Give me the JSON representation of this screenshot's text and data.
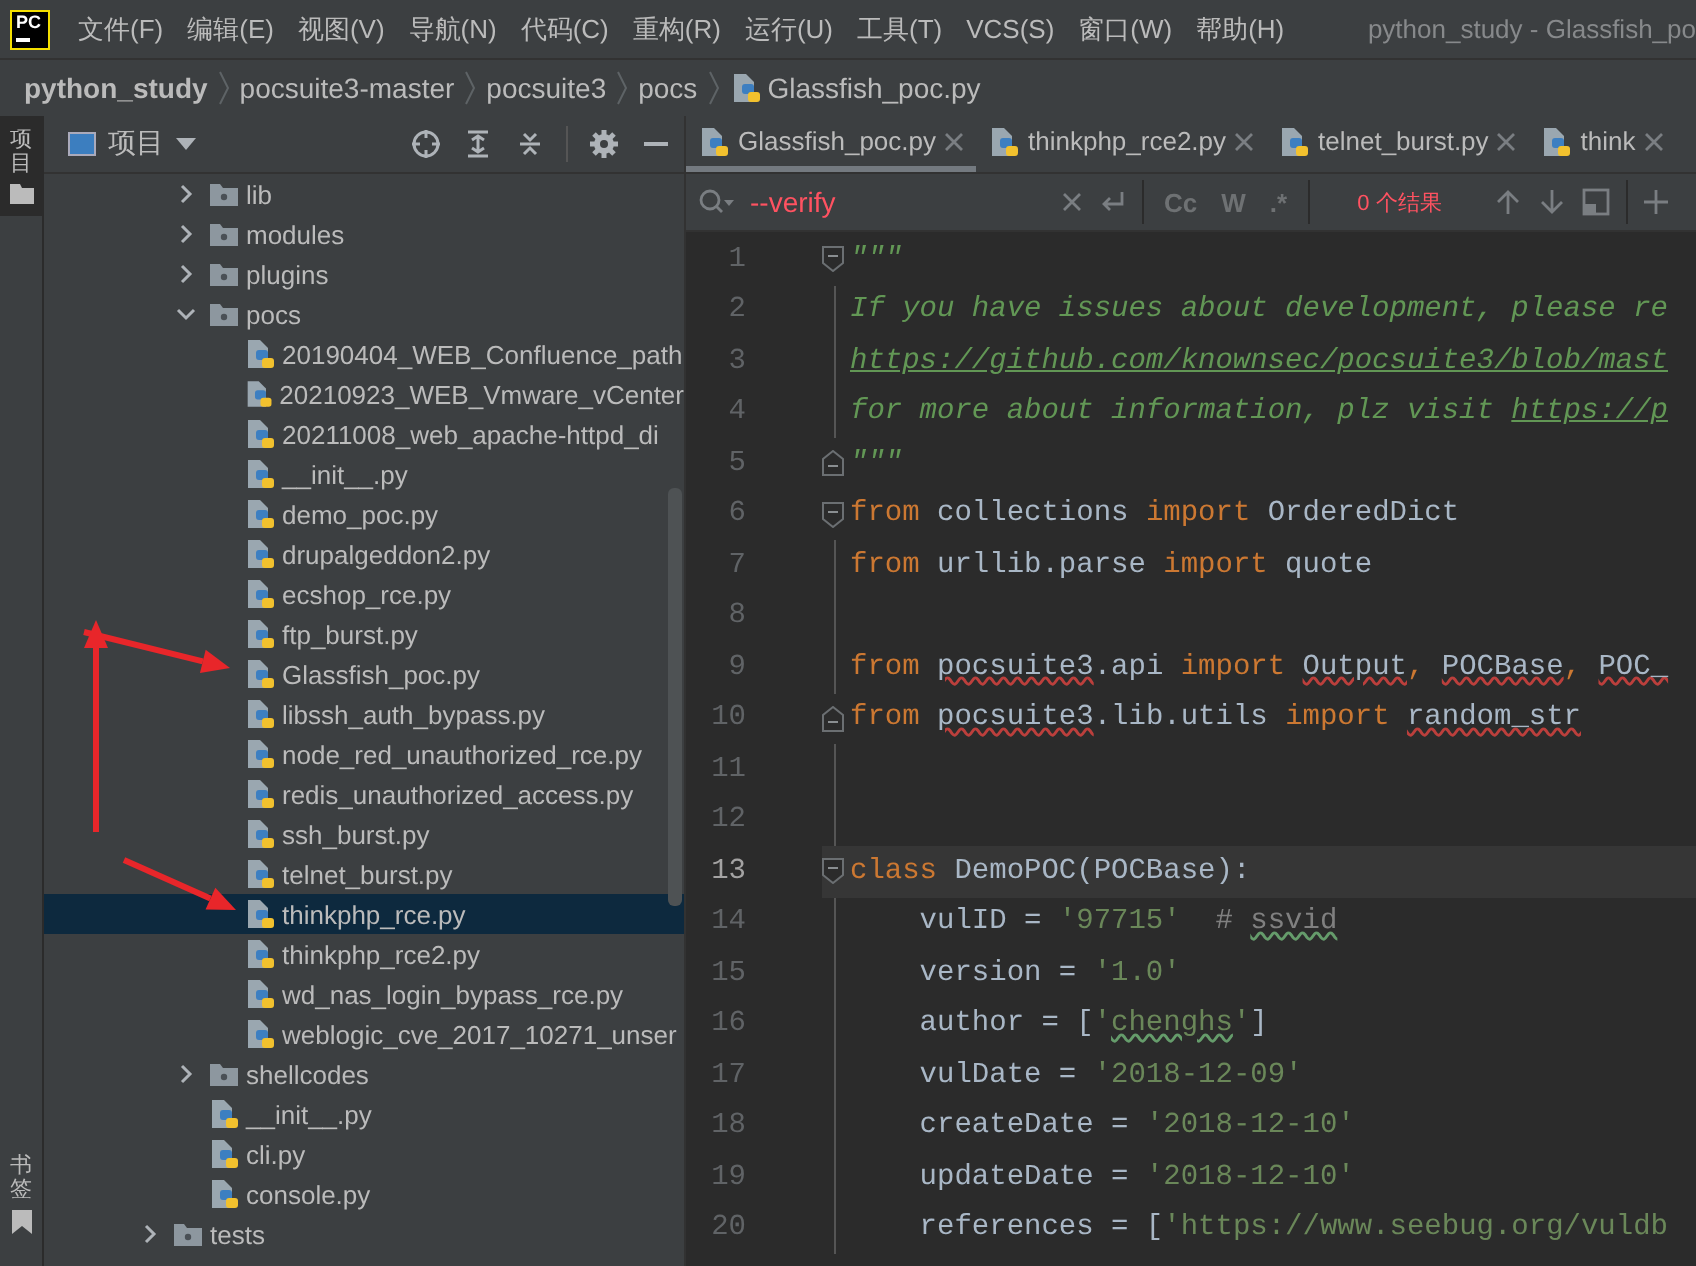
{
  "menu_bar": {
    "logo": "PC",
    "items": [
      "文件(F)",
      "编辑(E)",
      "视图(V)",
      "导航(N)",
      "代码(C)",
      "重构(R)",
      "运行(U)",
      "工具(T)",
      "VCS(S)",
      "窗口(W)",
      "帮助(H)"
    ],
    "title": "python_study - Glassfish_po"
  },
  "breadcrumb": [
    {
      "label": "python_study",
      "kind": "root"
    },
    {
      "label": "pocsuite3-master",
      "kind": "folder"
    },
    {
      "label": "pocsuite3",
      "kind": "folder"
    },
    {
      "label": "pocs",
      "kind": "folder"
    },
    {
      "label": "Glassfish_poc.py",
      "kind": "file"
    }
  ],
  "side_strip": {
    "top": "项目",
    "bottom": "书签"
  },
  "project": {
    "title": "项目",
    "tree": [
      {
        "children": [
          {
            "label": "lib",
            "kind": "folder",
            "expanded": false,
            "selected": false
          },
          {
            "label": "modules",
            "kind": "folder",
            "expanded": false,
            "selected": false
          },
          {
            "label": "plugins",
            "kind": "folder",
            "expanded": false,
            "selected": false
          },
          {
            "label": "pocs",
            "kind": "folder",
            "expanded": true,
            "selected": false,
            "children": [
              {
                "label": "20190404_WEB_Confluence_path",
                "kind": "file",
                "selected": false
              },
              {
                "label": "20210923_WEB_Vmware_vCenter",
                "kind": "file",
                "selected": false
              },
              {
                "label": "20211008_web_apache-httpd_di",
                "kind": "file",
                "selected": false
              },
              {
                "label": "__init__.py",
                "kind": "file",
                "selected": false
              },
              {
                "label": "demo_poc.py",
                "kind": "file",
                "selected": false
              },
              {
                "label": "drupalgeddon2.py",
                "kind": "file",
                "selected": false
              },
              {
                "label": "ecshop_rce.py",
                "kind": "file",
                "selected": false
              },
              {
                "label": "ftp_burst.py",
                "kind": "file",
                "selected": false
              },
              {
                "label": "Glassfish_poc.py",
                "kind": "file",
                "selected": false
              },
              {
                "label": "libssh_auth_bypass.py",
                "kind": "file",
                "selected": false
              },
              {
                "label": "node_red_unauthorized_rce.py",
                "kind": "file",
                "selected": false
              },
              {
                "label": "redis_unauthorized_access.py",
                "kind": "file",
                "selected": false
              },
              {
                "label": "ssh_burst.py",
                "kind": "file",
                "selected": false
              },
              {
                "label": "telnet_burst.py",
                "kind": "file",
                "selected": false
              },
              {
                "label": "thinkphp_rce.py",
                "kind": "file",
                "selected": true
              },
              {
                "label": "thinkphp_rce2.py",
                "kind": "file",
                "selected": false
              },
              {
                "label": "wd_nas_login_bypass_rce.py",
                "kind": "file",
                "selected": false
              },
              {
                "label": "weblogic_cve_2017_10271_unser",
                "kind": "file",
                "selected": false
              }
            ]
          },
          {
            "label": "shellcodes",
            "kind": "folder",
            "expanded": false,
            "selected": false
          },
          {
            "label": "__init__.py",
            "kind": "file",
            "selected": false
          },
          {
            "label": "cli.py",
            "kind": "file",
            "selected": false
          },
          {
            "label": "console.py",
            "kind": "file",
            "selected": false
          }
        ]
      },
      {
        "label": "tests",
        "kind": "folder",
        "expanded": false,
        "selected": false
      }
    ]
  },
  "editor": {
    "tabs": [
      {
        "label": "Glassfish_poc.py",
        "selected": true
      },
      {
        "label": "thinkphp_rce2.py",
        "selected": false
      },
      {
        "label": "telnet_burst.py",
        "selected": false
      },
      {
        "label": "think",
        "selected": false
      }
    ],
    "search": {
      "value": "--verify",
      "toggles": [
        "Cc",
        "W",
        ".*"
      ],
      "result": "0 个结果"
    },
    "lines": [
      {
        "number": "1",
        "fold_marker": {
          "kind": "open"
        },
        "current": false,
        "tokens": [
          {
            "kind": "doc",
            "text": "\"\"\""
          }
        ]
      },
      {
        "number": "2",
        "current": false,
        "tokens": [
          {
            "kind": "doc",
            "text": "If you have issues about development, please re"
          }
        ]
      },
      {
        "number": "3",
        "current": false,
        "tokens": [
          {
            "kind": "link",
            "text": "https://github.com/knownsec/pocsuite3/blob/mast"
          }
        ]
      },
      {
        "number": "4",
        "current": false,
        "tokens": [
          {
            "kind": "doc",
            "text": "for more about information, plz visit "
          },
          {
            "kind": "link",
            "text": "https://p"
          }
        ]
      },
      {
        "number": "5",
        "fold_marker": {
          "kind": "close"
        },
        "current": false,
        "tokens": [
          {
            "kind": "doc",
            "text": "\"\"\""
          }
        ]
      },
      {
        "number": "6",
        "fold_marker": {
          "kind": "open"
        },
        "current": false,
        "tokens": [
          {
            "kind": "keyword",
            "text": "from"
          },
          {
            "kind": "plain",
            "text": " collections "
          },
          {
            "kind": "keyword",
            "text": "import"
          },
          {
            "kind": "plain",
            "text": " OrderedDict"
          }
        ]
      },
      {
        "number": "7",
        "current": false,
        "tokens": [
          {
            "kind": "keyword",
            "text": "from"
          },
          {
            "kind": "plain",
            "text": " urllib.parse "
          },
          {
            "kind": "keyword",
            "text": "import"
          },
          {
            "kind": "plain",
            "text": " quote"
          }
        ]
      },
      {
        "number": "8",
        "current": false
      },
      {
        "number": "9",
        "current": false,
        "tokens": [
          {
            "kind": "keyword",
            "text": "from "
          },
          {
            "kind": "unresolved",
            "text": "pocsuite3"
          },
          {
            "kind": "plain",
            "text": ".api "
          },
          {
            "kind": "keyword",
            "text": "import "
          },
          {
            "kind": "unresolved",
            "text": "Output"
          },
          {
            "kind": "keyword",
            "text": ", "
          },
          {
            "kind": "unresolved",
            "text": "POCBase"
          },
          {
            "kind": "keyword",
            "text": ", "
          },
          {
            "kind": "unresolved",
            "text": "POC_"
          }
        ]
      },
      {
        "number": "10",
        "fold_marker": {
          "kind": "close"
        },
        "current": false,
        "tokens": [
          {
            "kind": "keyword",
            "text": "from "
          },
          {
            "kind": "unresolved",
            "text": "pocsuite3"
          },
          {
            "kind": "plain",
            "text": ".lib.utils "
          },
          {
            "kind": "keyword",
            "text": "import "
          },
          {
            "kind": "unresolved",
            "text": "random_str"
          }
        ]
      },
      {
        "number": "11",
        "current": false
      },
      {
        "number": "12",
        "current": false
      },
      {
        "number": "13",
        "fold_marker": {
          "kind": "open"
        },
        "current": true,
        "tokens": [
          {
            "kind": "keyword",
            "text": "class"
          },
          {
            "kind": "plain",
            "text": " DemoPOC(POCBase):"
          }
        ]
      },
      {
        "number": "14",
        "current": false,
        "tokens": [
          {
            "kind": "plain",
            "text": "    vulID = "
          },
          {
            "kind": "string",
            "text": "'97715'"
          },
          {
            "kind": "comment",
            "text": "  # "
          },
          {
            "kind": "comment-typo",
            "text": "ssvid"
          }
        ]
      },
      {
        "number": "15",
        "current": false,
        "tokens": [
          {
            "kind": "plain",
            "text": "    version = "
          },
          {
            "kind": "string",
            "text": "'1.0'"
          }
        ]
      },
      {
        "number": "16",
        "current": false,
        "tokens": [
          {
            "kind": "plain",
            "text": "    author = ["
          },
          {
            "kind": "string",
            "text": "'"
          },
          {
            "kind": "string-typo",
            "text": "chenghs"
          },
          {
            "kind": "string",
            "text": "'"
          },
          {
            "kind": "plain",
            "text": "]"
          }
        ]
      },
      {
        "number": "17",
        "current": false,
        "tokens": [
          {
            "kind": "plain",
            "text": "    vulDate = "
          },
          {
            "kind": "string",
            "text": "'2018-12-09'"
          }
        ]
      },
      {
        "number": "18",
        "current": false,
        "tokens": [
          {
            "kind": "plain",
            "text": "    createDate = "
          },
          {
            "kind": "string",
            "text": "'2018-12-10'"
          }
        ]
      },
      {
        "number": "19",
        "current": false,
        "tokens": [
          {
            "kind": "plain",
            "text": "    updateDate = "
          },
          {
            "kind": "string",
            "text": "'2018-12-10'"
          }
        ]
      },
      {
        "number": "20",
        "current": false,
        "tokens": [
          {
            "kind": "plain",
            "text": "    references = ["
          },
          {
            "kind": "string",
            "text": "'https://www.seebug.org/vuldb"
          }
        ]
      }
    ]
  }
}
